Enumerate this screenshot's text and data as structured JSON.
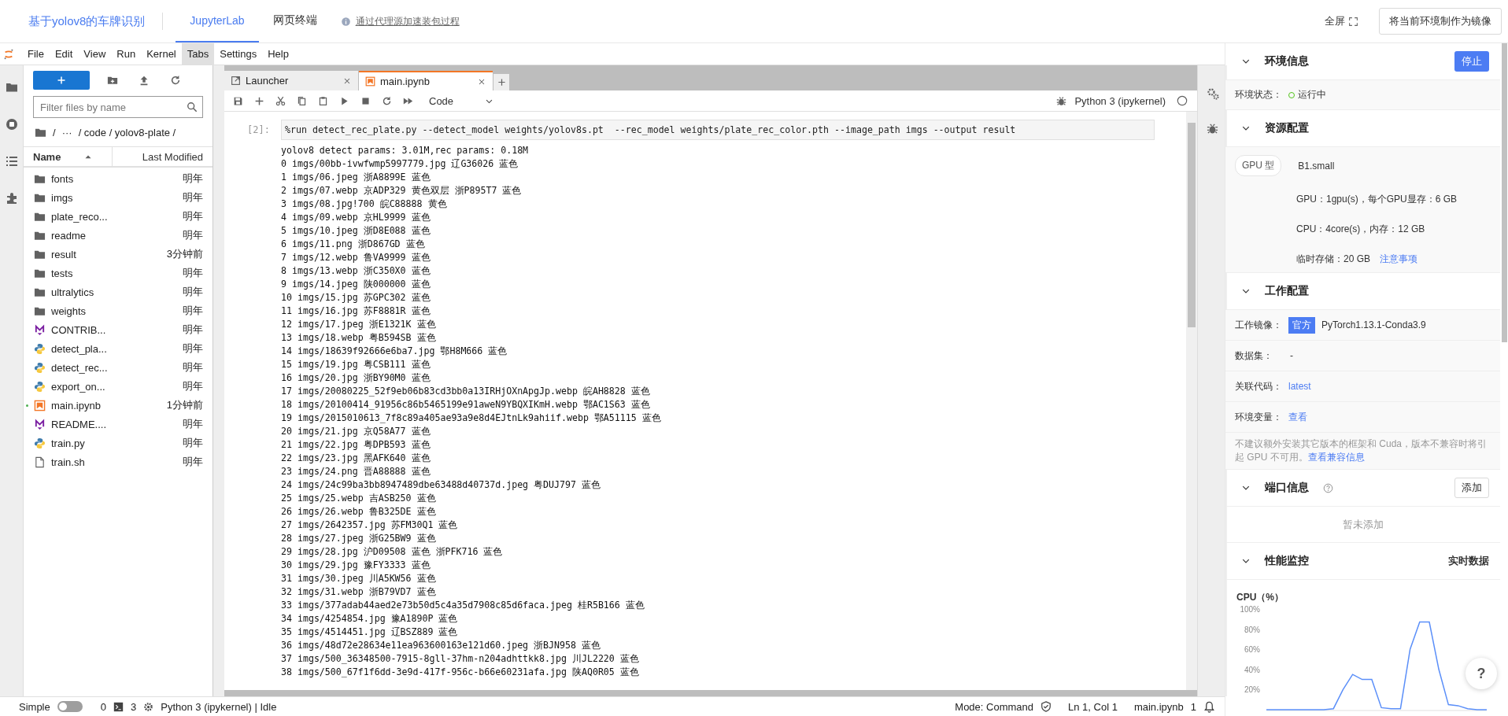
{
  "header": {
    "title": "基于yolov8的车牌识别",
    "tabs": [
      {
        "label": "JupyterLab",
        "selected": true
      },
      {
        "label": "网页终端",
        "selected": false
      }
    ],
    "proxy_link": "通过代理源加速装包过程",
    "fullscreen": "全屏",
    "save_image_button": "将当前环境制作为镜像"
  },
  "menu": [
    {
      "label": "File",
      "selected": false
    },
    {
      "label": "Edit",
      "selected": false
    },
    {
      "label": "View",
      "selected": false
    },
    {
      "label": "Run",
      "selected": false
    },
    {
      "label": "Kernel",
      "selected": false
    },
    {
      "label": "Tabs",
      "selected": true
    },
    {
      "label": "Settings",
      "selected": false
    },
    {
      "label": "Help",
      "selected": false
    }
  ],
  "file_browser": {
    "filter_placeholder": "Filter files by name",
    "breadcrumb": [
      "/",
      "···",
      "/ code / yolov8-plate /"
    ],
    "columns": [
      "Name",
      "Last Modified"
    ],
    "files": [
      {
        "name": "fonts",
        "kind": "folder",
        "modified": "明年",
        "running": false
      },
      {
        "name": "imgs",
        "kind": "folder",
        "modified": "明年",
        "running": false
      },
      {
        "name": "plate_reco...",
        "kind": "folder",
        "modified": "明年",
        "running": false
      },
      {
        "name": "readme",
        "kind": "folder",
        "modified": "明年",
        "running": false
      },
      {
        "name": "result",
        "kind": "folder",
        "modified": "3分钟前",
        "running": false
      },
      {
        "name": "tests",
        "kind": "folder",
        "modified": "明年",
        "running": false
      },
      {
        "name": "ultralytics",
        "kind": "folder",
        "modified": "明年",
        "running": false
      },
      {
        "name": "weights",
        "kind": "folder",
        "modified": "明年",
        "running": false
      },
      {
        "name": "CONTRIB...",
        "kind": "markdown",
        "modified": "明年",
        "running": false
      },
      {
        "name": "detect_pla...",
        "kind": "python",
        "modified": "明年",
        "running": false
      },
      {
        "name": "detect_rec...",
        "kind": "python",
        "modified": "明年",
        "running": false
      },
      {
        "name": "export_on...",
        "kind": "python",
        "modified": "明年",
        "running": false
      },
      {
        "name": "main.ipynb",
        "kind": "notebook",
        "modified": "1分钟前",
        "running": true
      },
      {
        "name": "README....",
        "kind": "markdown",
        "modified": "明年",
        "running": false
      },
      {
        "name": "train.py",
        "kind": "python",
        "modified": "明年",
        "running": false
      },
      {
        "name": "train.sh",
        "kind": "file",
        "modified": "明年",
        "running": false
      }
    ]
  },
  "notebook": {
    "tabs": [
      {
        "label": "Launcher",
        "kind": "launcher",
        "selected": false
      },
      {
        "label": "main.ipynb",
        "kind": "notebook",
        "selected": true
      }
    ],
    "cell_type": "Code",
    "kernel": "Python 3 (ipykernel)",
    "cell": {
      "prompt": "[2]:",
      "input": "%run detect_rec_plate.py --detect_model weights/yolov8s.pt  --rec_model weights/plate_rec_color.pth --image_path imgs --output result",
      "output": [
        "yolov8 detect params: 3.01M,rec params: 0.18M",
        "0 imgs/00bb-ivwfwmp5997779.jpg 辽G36026 蓝色",
        "1 imgs/06.jpeg 浙A8899E 蓝色",
        "2 imgs/07.webp 京ADP329 黄色双层 浙P895T7 蓝色",
        "3 imgs/08.jpg!700 皖C88888 黄色",
        "4 imgs/09.webp 京HL9999 蓝色",
        "5 imgs/10.jpeg 浙D8E088 蓝色",
        "6 imgs/11.png 浙D867GD 蓝色",
        "7 imgs/12.webp 鲁VA9999 蓝色",
        "8 imgs/13.webp 浙C350X0 蓝色",
        "9 imgs/14.jpeg 陕000000 蓝色",
        "10 imgs/15.jpg 苏GPC302 蓝色",
        "11 imgs/16.jpg 苏F8881R 蓝色",
        "12 imgs/17.jpeg 浙E1321K 蓝色",
        "13 imgs/18.webp 粤B594SB 蓝色",
        "14 imgs/18639f92666e6ba7.jpg 鄂H8M666 蓝色",
        "15 imgs/19.jpg 粤CSB111 蓝色",
        "16 imgs/20.jpg 浙BY90M0 蓝色",
        "17 imgs/20080225_52f9eb06b83cd3bb0a13IRHjOXnApgJp.webp 皖AH8828 蓝色",
        "18 imgs/20100414_91956c86b5465199e91aweN9YBQXIKmH.webp 鄂AC1S63 蓝色",
        "19 imgs/2015010613_7f8c89a405ae93a9e8d4EJtnLk9ahiif.webp 鄂A51115 蓝色",
        "20 imgs/21.jpg 京Q58A77 蓝色",
        "21 imgs/22.jpg 粤DPB593 蓝色",
        "22 imgs/23.jpg 黑AFK640 蓝色",
        "23 imgs/24.png 晋A88888 蓝色",
        "24 imgs/24c99ba3bb8947489dbe63488d40737d.jpeg 粤DUJ797 蓝色",
        "25 imgs/25.webp 吉ASB250 蓝色",
        "26 imgs/26.webp 鲁B325DE 蓝色",
        "27 imgs/2642357.jpg 苏FM30Q1 蓝色",
        "28 imgs/27.jpeg 浙G25BW9 蓝色",
        "29 imgs/28.jpg 沪D09508 蓝色 浙PFK716 蓝色",
        "30 imgs/29.jpg 豫FY3333 蓝色",
        "31 imgs/30.jpeg 川A5KW56 蓝色",
        "32 imgs/31.webp 浙B79VD7 蓝色",
        "33 imgs/377adab44aed2e73b50d5c4a35d7908c85d6faca.jpeg 桂R5B166 蓝色",
        "34 imgs/4254854.jpg 豫A1890P 蓝色",
        "35 imgs/4514451.jpg 辽BSZ889 蓝色",
        "36 imgs/48d72e28634e11ea963600163e121d60.jpeg 浙BJN958 蓝色",
        "37 imgs/500_36348500-7915-8gll-37hm-n204adhttkk8.jpg 川JL2220 蓝色",
        "38 imgs/500_67f1f6dd-3e9d-417f-956c-b66e60231afa.jpg 陕AQ0R05 蓝色"
      ]
    }
  },
  "status_bar": {
    "mode_label": "Simple",
    "simple_on": false,
    "terminals": "0",
    "kernels": "3",
    "kernel_status": "Python 3 (ipykernel) | Idle",
    "mode": "Mode: Command",
    "position": "Ln 1, Col 1",
    "file": "main.ipynb",
    "notifications": "1"
  },
  "env_info": {
    "title": "环境信息",
    "stop_button": "停止",
    "status_label": "环境状态：",
    "status": "运行中",
    "running": true
  },
  "resources": {
    "title": "资源配置",
    "gpu_tag": "GPU 型",
    "spec": "B1.small",
    "lines": [
      "GPU：1gpu(s)，每个GPU显存：6 GB",
      "CPU：4core(s)，内存：12 GB"
    ],
    "storage": "临时存储：20 GB",
    "storage_link": "注意事项"
  },
  "work_config": {
    "title": "工作配置",
    "rows": [
      {
        "label": "工作镜像：",
        "kind": "badge",
        "badge": "官方",
        "value": "PyTorch1.13.1-Conda3.9"
      },
      {
        "label": "数据集：",
        "kind": "text",
        "value": "-"
      },
      {
        "label": "关联代码：",
        "kind": "link",
        "value": "latest"
      },
      {
        "label": "环境变量：",
        "kind": "link",
        "value": "查看"
      }
    ],
    "note": "不建议额外安装其它版本的框架和 Cuda，版本不兼容时将引起 GPU 不可用。",
    "note_link": "查看兼容信息"
  },
  "ports": {
    "title": "端口信息",
    "add_button": "添加",
    "empty": "暂未添加"
  },
  "monitor": {
    "title": "性能监控",
    "realtime": "实时数据",
    "chart_data": {
      "type": "line",
      "title": "CPU（%）",
      "ylim": [
        0,
        100
      ],
      "yticks": [
        {
          "value": 20,
          "label": "20%"
        },
        {
          "value": 40,
          "label": "40%"
        },
        {
          "value": 60,
          "label": "60%"
        },
        {
          "value": 80,
          "label": "80%"
        },
        {
          "value": 100,
          "label": "100%"
        }
      ],
      "series": [
        {
          "color": "#5b8ff9",
          "values": [
            0,
            0,
            0,
            0,
            0,
            0,
            0,
            1,
            20,
            35,
            30,
            30,
            2,
            1,
            1,
            60,
            87,
            87,
            40,
            5,
            4,
            1,
            0,
            0
          ]
        }
      ]
    }
  },
  "help_button": "?"
}
